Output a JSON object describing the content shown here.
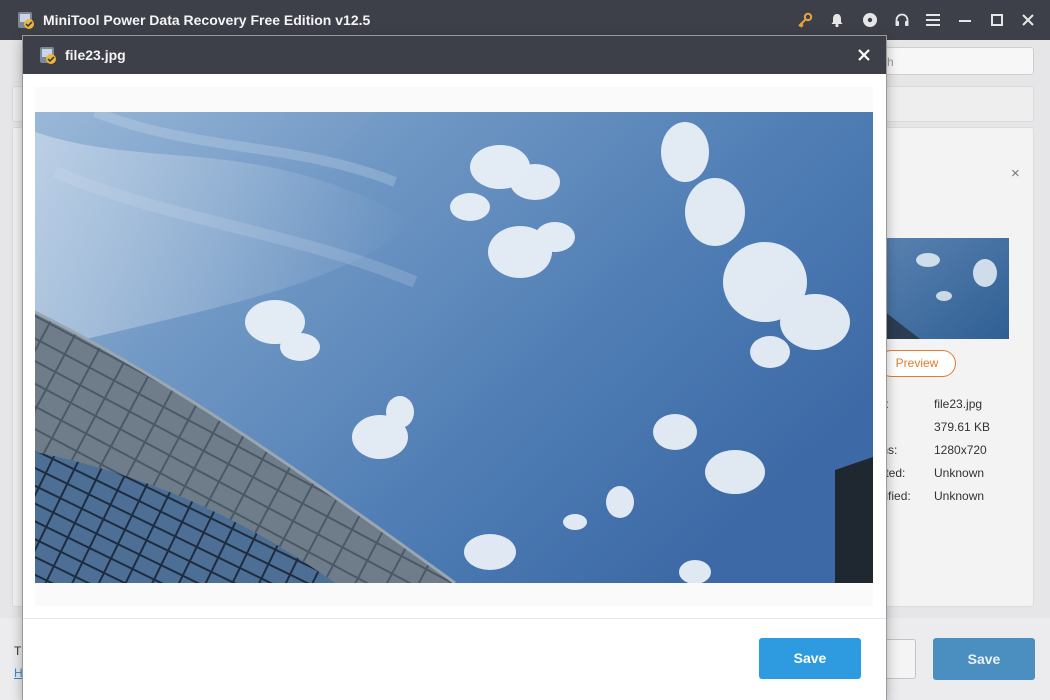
{
  "app": {
    "title": "MiniTool Power Data Recovery Free Edition v12.5",
    "icons": [
      "app-logo-icon",
      "key-icon",
      "bell-icon",
      "disc-icon",
      "headset-icon",
      "menu-icon",
      "minimize-icon",
      "maximize-icon",
      "close-icon"
    ]
  },
  "background": {
    "search_placeholder": "rch",
    "panel_close": "×",
    "preview_button": "Preview",
    "info": [
      {
        "label": "ne:",
        "value": "file23.jpg"
      },
      {
        "label": "",
        "value": "379.61 KB"
      },
      {
        "label": "ions:",
        "value": "1280x720"
      },
      {
        "label": "eated:",
        "value": "Unknown"
      },
      {
        "label": "odified:",
        "value": "Unknown"
      }
    ],
    "bottom_text": "T",
    "bottom_link": "H",
    "save_button": "Save"
  },
  "modal": {
    "title": "file23.jpg",
    "close": "×",
    "save_button": "Save"
  },
  "colors": {
    "titlebar": "#3e4049",
    "accent_blue": "#2e9ae0",
    "accent_orange": "#e07c2b",
    "key_icon": "#e9a33a"
  }
}
